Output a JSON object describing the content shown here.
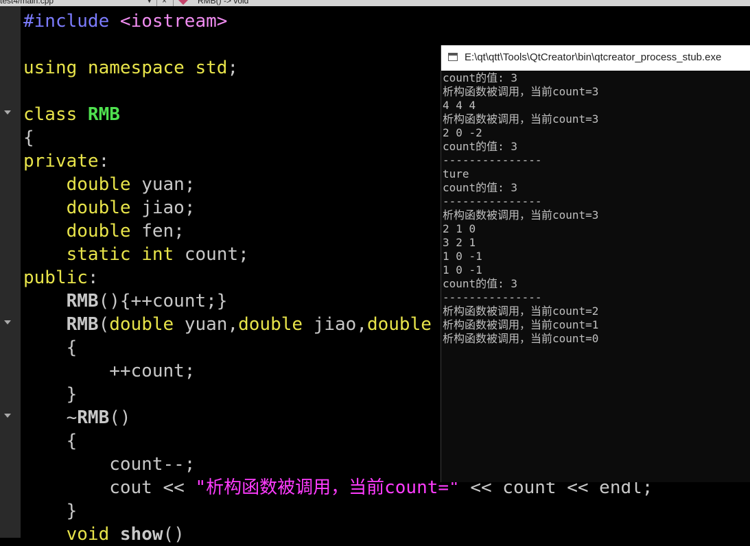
{
  "topbar": {
    "file": "test4/main.cpp",
    "close": "×",
    "symbol": "RMB() -> void"
  },
  "code_lines": [
    [
      {
        "t": "#include ",
        "c": "pp"
      },
      {
        "t": "<iostream>",
        "c": "inc"
      }
    ],
    [],
    [
      {
        "t": "using ",
        "c": "kw"
      },
      {
        "t": "namespace ",
        "c": "kw"
      },
      {
        "t": "std",
        "c": "kw"
      },
      {
        "t": ";",
        "c": "pl"
      }
    ],
    [],
    [
      {
        "t": "class ",
        "c": "kw"
      },
      {
        "t": "RMB",
        "c": "cls"
      }
    ],
    [
      {
        "t": "{",
        "c": "pl"
      }
    ],
    [
      {
        "t": "private",
        "c": "kw"
      },
      {
        "t": ":",
        "c": "pl"
      }
    ],
    [
      {
        "t": "    ",
        "c": "pl"
      },
      {
        "t": "double ",
        "c": "kw"
      },
      {
        "t": "yuan",
        "c": "id"
      },
      {
        "t": ";",
        "c": "pl"
      }
    ],
    [
      {
        "t": "    ",
        "c": "pl"
      },
      {
        "t": "double ",
        "c": "kw"
      },
      {
        "t": "jiao",
        "c": "id"
      },
      {
        "t": ";",
        "c": "pl"
      }
    ],
    [
      {
        "t": "    ",
        "c": "pl"
      },
      {
        "t": "double ",
        "c": "kw"
      },
      {
        "t": "fen",
        "c": "id"
      },
      {
        "t": ";",
        "c": "pl"
      }
    ],
    [
      {
        "t": "    ",
        "c": "pl"
      },
      {
        "t": "static ",
        "c": "kw"
      },
      {
        "t": "int ",
        "c": "kw"
      },
      {
        "t": "count",
        "c": "id"
      },
      {
        "t": ";",
        "c": "pl"
      }
    ],
    [
      {
        "t": "public",
        "c": "kw"
      },
      {
        "t": ":",
        "c": "pl"
      }
    ],
    [
      {
        "t": "    ",
        "c": "pl"
      },
      {
        "t": "RMB",
        "c": "fn"
      },
      {
        "t": "(){++count;}",
        "c": "pl"
      }
    ],
    [
      {
        "t": "    ",
        "c": "pl"
      },
      {
        "t": "RMB",
        "c": "fn"
      },
      {
        "t": "(",
        "c": "pl"
      },
      {
        "t": "double ",
        "c": "kw"
      },
      {
        "t": "yuan",
        "c": "id"
      },
      {
        "t": ",",
        "c": "pl"
      },
      {
        "t": "double ",
        "c": "kw"
      },
      {
        "t": "jiao",
        "c": "id"
      },
      {
        "t": ",",
        "c": "pl"
      },
      {
        "t": "double",
        "c": "kw"
      }
    ],
    [
      {
        "t": "    {",
        "c": "pl"
      }
    ],
    [
      {
        "t": "        ++count;",
        "c": "pl"
      }
    ],
    [
      {
        "t": "    }",
        "c": "pl"
      }
    ],
    [
      {
        "t": "    ~",
        "c": "pl"
      },
      {
        "t": "RMB",
        "c": "fn"
      },
      {
        "t": "()",
        "c": "pl"
      }
    ],
    [
      {
        "t": "    {",
        "c": "pl"
      }
    ],
    [
      {
        "t": "        count--;",
        "c": "pl"
      }
    ],
    [
      {
        "t": "        cout << ",
        "c": "pl"
      },
      {
        "t": "\"析构函数被调用，当前count=\"",
        "c": "str"
      },
      {
        "t": " << count << endl;",
        "c": "pl"
      }
    ],
    [
      {
        "t": "    }",
        "c": "pl"
      }
    ],
    [
      {
        "t": "    ",
        "c": "pl"
      },
      {
        "t": "void ",
        "c": "kw"
      },
      {
        "t": "show",
        "c": "fn"
      },
      {
        "t": "()",
        "c": "pl"
      }
    ]
  ],
  "console": {
    "title": "E:\\qt\\qtt\\Tools\\QtCreator\\bin\\qtcreator_process_stub.exe",
    "lines": [
      "count的值: 3",
      "析构函数被调用，当前count=3",
      "4 4 4",
      "析构函数被调用，当前count=3",
      "2 0 -2",
      "count的值: 3",
      "---------------",
      "ture",
      "count的值: 3",
      "---------------",
      "析构函数被调用，当前count=3",
      "2 1 0",
      "3 2 1",
      "1 0 -1",
      "1 0 -1",
      "count的值: 3",
      "---------------",
      "析构函数被调用，当前count=2",
      "析构函数被调用，当前count=1",
      "析构函数被调用，当前count=0"
    ]
  },
  "colors": {
    "keyword": "#e8e44a",
    "class_name": "#4fe14f",
    "string": "#ff3cff",
    "preprocessor": "#7c7cff",
    "plain": "#c8c8c8"
  }
}
